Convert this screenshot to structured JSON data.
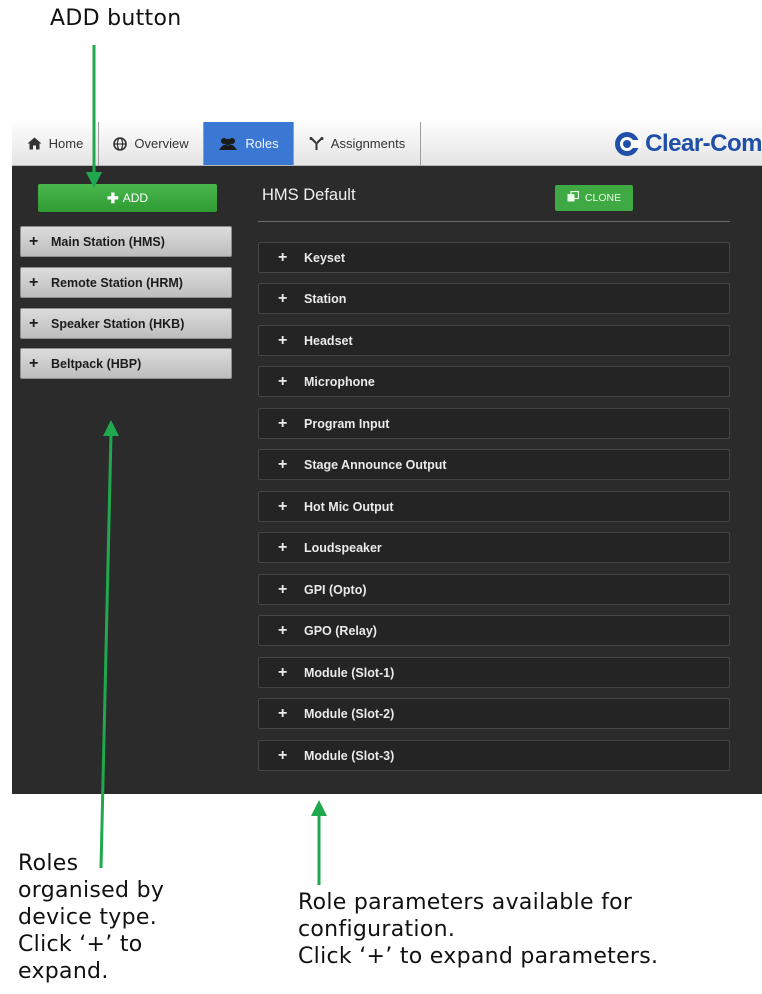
{
  "callouts": {
    "add": "ADD button",
    "roles_lines": [
      "Roles",
      "organised by",
      "device type.",
      "Click ‘+’ to",
      "expand."
    ],
    "params_lines": [
      "Role parameters available for",
      "configuration.",
      "Click ‘+’ to expand parameters."
    ]
  },
  "nav": {
    "tabs": [
      {
        "label": "Home",
        "icon": "home-icon",
        "active": false
      },
      {
        "label": "Overview",
        "icon": "globe-icon",
        "active": false
      },
      {
        "label": "Roles",
        "icon": "users-icon",
        "active": true
      },
      {
        "label": "Assignments",
        "icon": "assignments-icon",
        "active": false
      }
    ],
    "logo_text": "Clear-Com"
  },
  "sidebar": {
    "add_label": "ADD",
    "roles": [
      "Main Station (HMS)",
      "Remote Station (HRM)",
      "Speaker Station (HKB)",
      "Beltpack (HBP)"
    ]
  },
  "main": {
    "title": "HMS Default",
    "clone_label": "CLONE",
    "parameters": [
      "Keyset",
      "Station",
      "Headset",
      "Microphone",
      "Program Input",
      "Stage Announce Output",
      "Hot Mic Output",
      "Loudspeaker",
      "GPI (Opto)",
      "GPO (Relay)",
      "Module (Slot-1)",
      "Module (Slot-2)",
      "Module (Slot-3)"
    ]
  },
  "colors": {
    "accent_green": "#3faa44",
    "arrow_green": "#20a84e",
    "active_tab": "#3b78d4",
    "background_dark": "#2b2b2b",
    "logo_blue": "#1f4fa8"
  }
}
